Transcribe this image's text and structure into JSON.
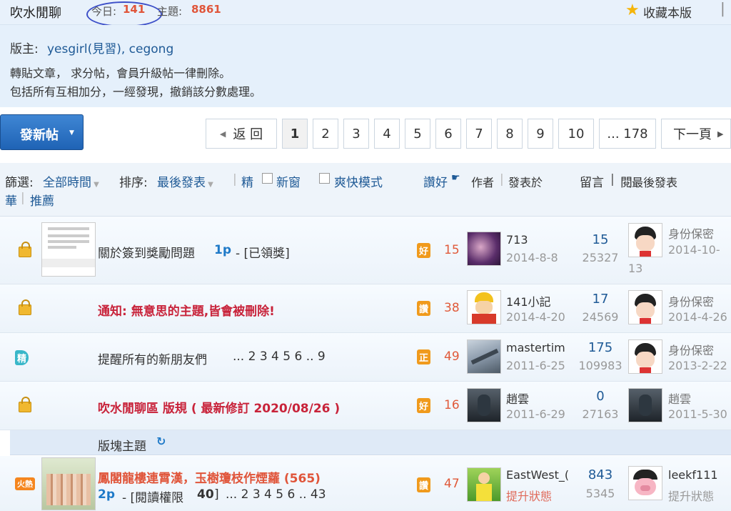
{
  "header": {
    "forum_name": "吹水閒聊",
    "today_label": "今日:",
    "today_count": "141",
    "topics_label": "主題:",
    "topics_count": "8861",
    "favorite_label": "收藏本版",
    "close_symbol": "▕"
  },
  "info": {
    "moderator_label": "版主:",
    "moderator_names": "yesgirl(見習), cegong",
    "rule_line_1": "轉貼文章， 求分帖，會員升級帖一律刪除。",
    "rule_line_2": "包括所有互相加分，一經發現，撤銷該分數處理。"
  },
  "toolbar": {
    "new_post_label": "發新帖"
  },
  "pagination": {
    "back_label": "返 回",
    "pages": [
      "1",
      "2",
      "3",
      "4",
      "5",
      "6",
      "7",
      "8",
      "9",
      "10"
    ],
    "current_page": "1",
    "last_label": "... 178",
    "next_label": "下一頁"
  },
  "filter": {
    "filter_label": "篩選:",
    "time_label": "全部時間",
    "sort_label": "排序:",
    "sort_value": "最後發表",
    "digest_label": "精",
    "new_window_label": "新窗",
    "fast_mode_label": "爽快模式",
    "like_label": "讚好",
    "author_label": "作者",
    "posted_label": "發表於",
    "replies_label": "留言",
    "views_label": "閱",
    "last_post_label": "最後發表",
    "hua_label": "華",
    "recommend_label": "推薦"
  },
  "threads": [
    {
      "title": "關於簽到獎勵問題",
      "page_tag": "1p",
      "suffix": "- [已領獎]",
      "badge": "好",
      "score": "15",
      "author": "713",
      "date": "2014-8-8",
      "replies": "15",
      "views": "25327",
      "last_author": "身份保密",
      "last_date_1": "2014-10-",
      "last_date_2": "13"
    },
    {
      "title": "通知: 無意思的主題,皆會被刪除!",
      "badge": "讚",
      "score": "38",
      "author": "141小記",
      "date": "2014-4-20",
      "replies": "17",
      "views": "24569",
      "last_author": "身份保密",
      "last_date_1": "2014-4-26"
    },
    {
      "title": "提醒所有的新朋友們",
      "pages": "... 2 3 4 5 6 .. 9",
      "tag": "精",
      "badge": "正",
      "score": "49",
      "author": "mastertim",
      "date": "2011-6-25",
      "replies": "175",
      "views": "109983",
      "last_author": "身份保密",
      "last_date_1": "2013-2-22"
    },
    {
      "title": "吹水閒聊區 版規 ( 最新修訂 2020/08/26 )",
      "badge": "好",
      "score": "16",
      "author": "趙雲",
      "date": "2011-6-29",
      "replies": "0",
      "views": "27163",
      "last_author": "趙雲",
      "last_date_1": "2011-5-30"
    }
  ],
  "section_label": "版塊主題",
  "hot_thread": {
    "tag": "火熱",
    "title": "鳳閣龍樓連霄漢，玉樹瓊枝作煙蘿 (565)",
    "page_tag": "2p",
    "perm_label": "- [閱讀權限",
    "perm_value": "40",
    "perm_end": "]",
    "pages": "... 2 3 4 5 6 .. 43",
    "badge": "讚",
    "score": "47",
    "author": "EastWest_(",
    "author_status": "提升狀態",
    "replies": "843",
    "views": "5345",
    "last_author": "leekf111",
    "last_status": "提升狀態"
  },
  "colors": {
    "accent_blue": "#1f5a96",
    "alert_red": "#c8233a",
    "count_orange": "#e0553a"
  }
}
